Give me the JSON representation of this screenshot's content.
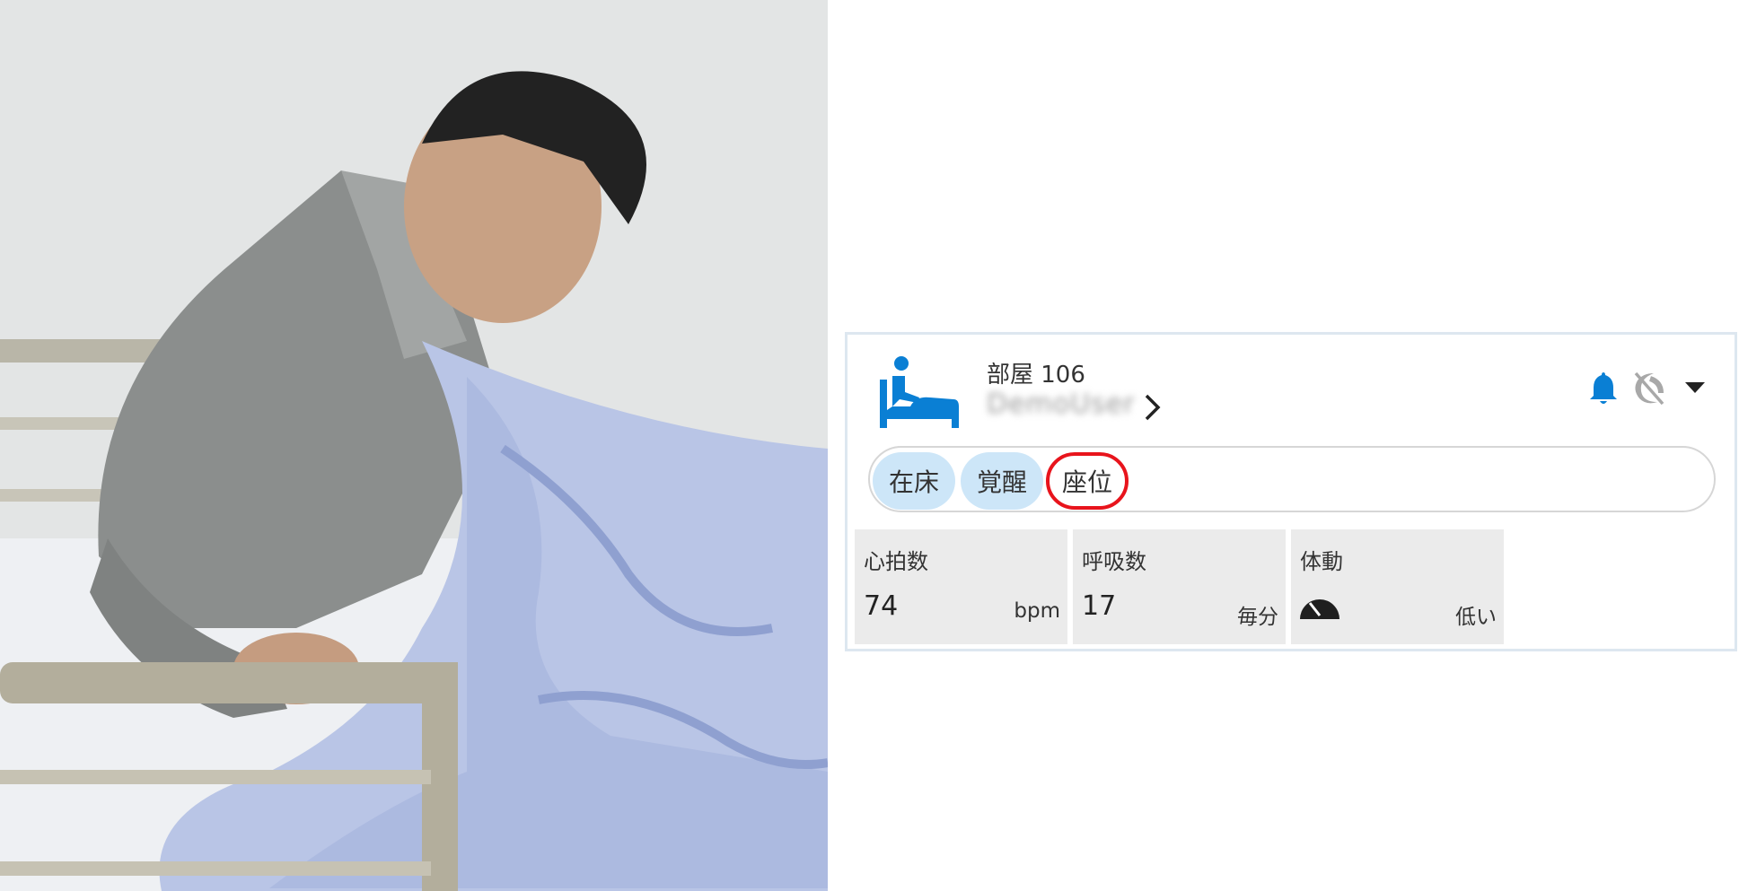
{
  "card": {
    "room_label": "部屋 106",
    "user_name": "DemoUser",
    "icons": {
      "bed": "person-in-bed-icon",
      "notification": "bell-icon",
      "sleep_off": "moon-off-icon",
      "expand": "caret-down-icon",
      "detail": "chevron-right-icon"
    },
    "colors": {
      "accent": "#0a7fd4",
      "chip_active": "#cde6f8",
      "highlight": "#e8141c"
    }
  },
  "status_chips": [
    {
      "label": "在床",
      "active": true
    },
    {
      "label": "覚醒",
      "active": true
    },
    {
      "label": "座位",
      "active": false,
      "highlighted": true
    }
  ],
  "metrics": [
    {
      "label": "心拍数",
      "value": "74",
      "unit": "bpm"
    },
    {
      "label": "呼吸数",
      "value": "17",
      "unit": "毎分"
    },
    {
      "label": "体動",
      "value_icon": "gauge-icon",
      "unit": "低い"
    }
  ]
}
